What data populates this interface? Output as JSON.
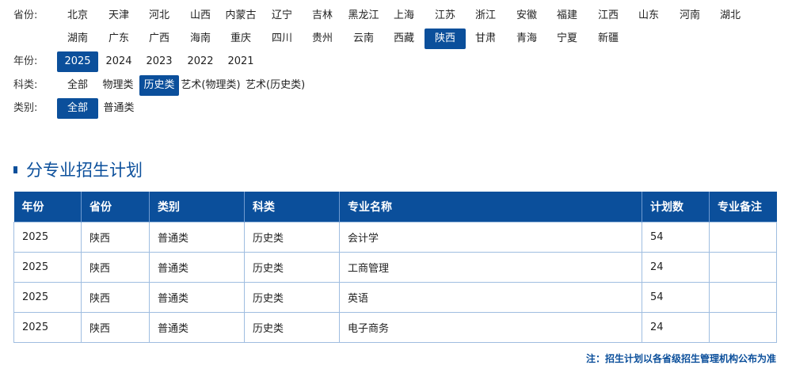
{
  "filters": {
    "province": {
      "label": "省份:",
      "row1": [
        "北京",
        "天津",
        "河北",
        "山西",
        "内蒙古",
        "辽宁",
        "吉林",
        "黑龙江",
        "上海",
        "江苏",
        "浙江",
        "安徽",
        "福建",
        "江西",
        "山东",
        "河南",
        "湖北"
      ],
      "row2": [
        "湖南",
        "广东",
        "广西",
        "海南",
        "重庆",
        "四川",
        "贵州",
        "云南",
        "西藏",
        "陕西",
        "甘肃",
        "青海",
        "宁夏",
        "新疆"
      ],
      "selected": "陕西"
    },
    "year": {
      "label": "年份:",
      "options": [
        "2025",
        "2024",
        "2023",
        "2022",
        "2021"
      ],
      "selected": "2025"
    },
    "subject": {
      "label": "科类:",
      "options": [
        "全部",
        "物理类",
        "历史类",
        "艺术(物理类)",
        "艺术(历史类)"
      ],
      "selected": "历史类"
    },
    "category": {
      "label": "类别:",
      "options": [
        "全部",
        "普通类"
      ],
      "selected": "全部"
    }
  },
  "section": {
    "title": "分专业招生计划"
  },
  "table": {
    "headers": [
      "年份",
      "省份",
      "类别",
      "科类",
      "专业名称",
      "计划数",
      "专业备注"
    ],
    "rows": [
      [
        "2025",
        "陕西",
        "普通类",
        "历史类",
        "会计学",
        "54",
        ""
      ],
      [
        "2025",
        "陕西",
        "普通类",
        "历史类",
        "工商管理",
        "24",
        ""
      ],
      [
        "2025",
        "陕西",
        "普通类",
        "历史类",
        "英语",
        "54",
        ""
      ],
      [
        "2025",
        "陕西",
        "普通类",
        "历史类",
        "电子商务",
        "24",
        ""
      ]
    ]
  },
  "note": "注：招生计划以各省级招生管理机构公布为准",
  "colors": {
    "accent": "#0b4f9b",
    "border": "#9fbde0"
  }
}
